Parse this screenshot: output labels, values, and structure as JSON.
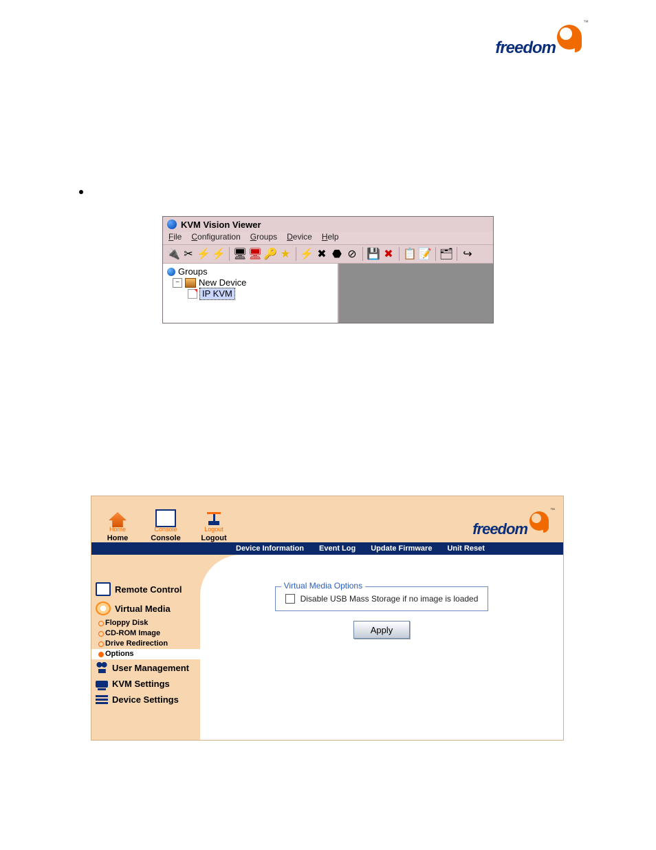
{
  "brand": {
    "word": "freedom",
    "tm": "™"
  },
  "fig1": {
    "title": "KVM Vision Viewer",
    "menus": {
      "file": {
        "letter": "F",
        "rest": "ile"
      },
      "config": {
        "letter": "C",
        "rest": "onfiguration"
      },
      "groups": {
        "letter": "G",
        "rest": "roups"
      },
      "device": {
        "letter": "D",
        "rest": "evice"
      },
      "help": {
        "letter": "H",
        "rest": "elp"
      }
    },
    "toolbar_icons": [
      "connect-icon",
      "disconnect-icon",
      "bolt-a-icon",
      "bolt-b-icon",
      "monitor-icon",
      "monitor-red-icon",
      "key-icon",
      "star-icon",
      "flash-icon",
      "x-icon",
      "shield-icon",
      "cancel-icon",
      "disk-icon",
      "disk-x-icon",
      "props-icon",
      "props2-icon",
      "tree-icon",
      "exit-icon"
    ],
    "tree": {
      "root": "Groups",
      "node": "New Device",
      "leaf": "IP KVM"
    }
  },
  "fig2": {
    "top_icons": {
      "home": {
        "caption": "Home",
        "label": "Home"
      },
      "console": {
        "caption": "Console",
        "label": "Console"
      },
      "logout": {
        "caption": "Logout",
        "label": "Logout"
      }
    },
    "nav": {
      "device_info": "Device Information",
      "event_log": "Event Log",
      "update_firmware": "Update Firmware",
      "unit_reset": "Unit Reset"
    },
    "sidebar": {
      "remote": "Remote Control",
      "vmedia": "Virtual Media",
      "floppy": "Floppy Disk",
      "cdrom": "CD-ROM Image",
      "drive": "Drive Redirection",
      "options": "Options",
      "usermgmt": "User Management",
      "kvm": "KVM Settings",
      "devset": "Device Settings"
    },
    "panel": {
      "legend": "Virtual Media Options",
      "checkbox_label": "Disable USB Mass Storage if no image is loaded",
      "apply": "Apply"
    }
  }
}
